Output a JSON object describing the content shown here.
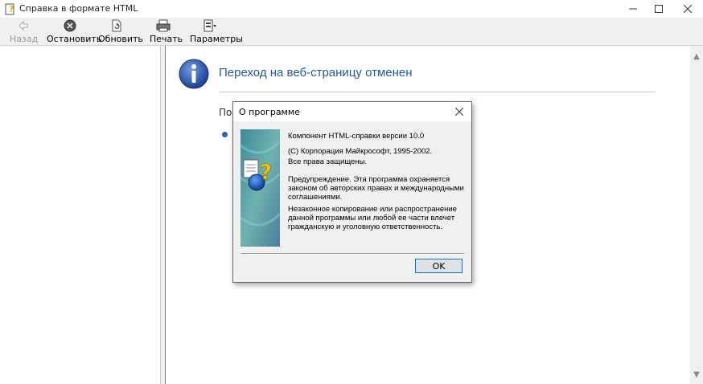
{
  "window": {
    "title": "Справка в формате HTML",
    "icon": "help-icon"
  },
  "toolbar": {
    "back": "Назад",
    "stop": "Остановить",
    "refresh": "Обновить",
    "print": "Печать",
    "options": "Параметры"
  },
  "content": {
    "heading": "Переход на веб-страницу отменен",
    "partial_text": "По"
  },
  "dialog": {
    "title": "О программе",
    "version": "Компонент HTML-справки версии 10.0",
    "copyright": "(С) Корпорация Майкрософт, 1995-2002.",
    "rights": "Все права защищены.",
    "warning_1": "Предупреждение. Эта программа охраняется",
    "warning_2": "законом об авторских правах и международными",
    "warning_3": "соглашениями.",
    "illegal_1": "Незаконное копирование или распространение",
    "illegal_2": "данной программы или любой ее части влечет",
    "illegal_3": "гражданскую и уголовную ответственность.",
    "ok": "OK"
  },
  "colors": {
    "heading": "#2457a6",
    "accent": "#0078d7"
  }
}
